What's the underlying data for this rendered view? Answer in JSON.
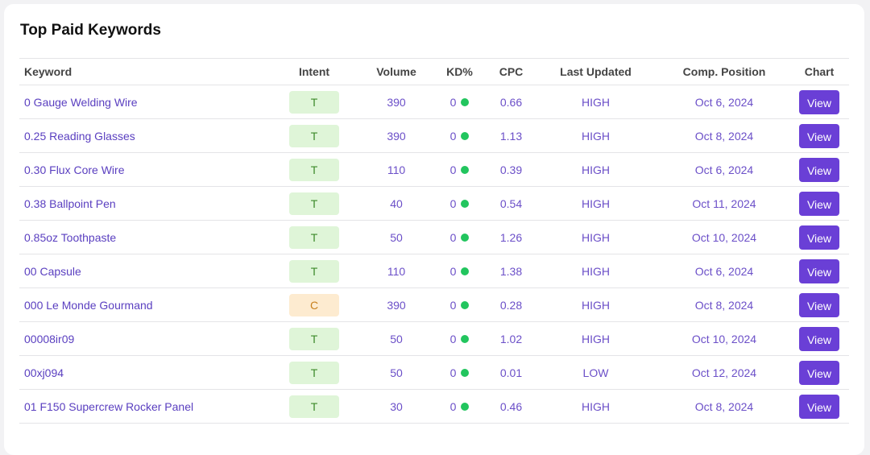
{
  "title": "Top Paid Keywords",
  "colors": {
    "accent": "#6a3fd6",
    "intent_t_bg": "#dff5d8",
    "intent_c_bg": "#fdebd0",
    "kd_dot": "#22c55e"
  },
  "columns": [
    "Keyword",
    "Intent",
    "Volume",
    "KD%",
    "CPC",
    "Last Updated",
    "Comp. Position",
    "Chart"
  ],
  "rows": [
    {
      "keyword": "0 Gauge Welding Wire",
      "intent": "T",
      "volume": "390",
      "kd": "0",
      "cpc": "0.66",
      "last_updated": "HIGH",
      "comp_position": "Oct 6, 2024",
      "chart": "View"
    },
    {
      "keyword": "0.25 Reading Glasses",
      "intent": "T",
      "volume": "390",
      "kd": "0",
      "cpc": "1.13",
      "last_updated": "HIGH",
      "comp_position": "Oct 8, 2024",
      "chart": "View"
    },
    {
      "keyword": "0.30 Flux Core Wire",
      "intent": "T",
      "volume": "110",
      "kd": "0",
      "cpc": "0.39",
      "last_updated": "HIGH",
      "comp_position": "Oct 6, 2024",
      "chart": "View"
    },
    {
      "keyword": "0.38 Ballpoint Pen",
      "intent": "T",
      "volume": "40",
      "kd": "0",
      "cpc": "0.54",
      "last_updated": "HIGH",
      "comp_position": "Oct 11, 2024",
      "chart": "View"
    },
    {
      "keyword": "0.85oz Toothpaste",
      "intent": "T",
      "volume": "50",
      "kd": "0",
      "cpc": "1.26",
      "last_updated": "HIGH",
      "comp_position": "Oct 10, 2024",
      "chart": "View"
    },
    {
      "keyword": "00 Capsule",
      "intent": "T",
      "volume": "110",
      "kd": "0",
      "cpc": "1.38",
      "last_updated": "HIGH",
      "comp_position": "Oct 6, 2024",
      "chart": "View"
    },
    {
      "keyword": "000 Le Monde Gourmand",
      "intent": "C",
      "volume": "390",
      "kd": "0",
      "cpc": "0.28",
      "last_updated": "HIGH",
      "comp_position": "Oct 8, 2024",
      "chart": "View"
    },
    {
      "keyword": "00008ir09",
      "intent": "T",
      "volume": "50",
      "kd": "0",
      "cpc": "1.02",
      "last_updated": "HIGH",
      "comp_position": "Oct 10, 2024",
      "chart": "View"
    },
    {
      "keyword": "00xj094",
      "intent": "T",
      "volume": "50",
      "kd": "0",
      "cpc": "0.01",
      "last_updated": "LOW",
      "comp_position": "Oct 12, 2024",
      "chart": "View"
    },
    {
      "keyword": "01 F150 Supercrew Rocker Panel",
      "intent": "T",
      "volume": "30",
      "kd": "0",
      "cpc": "0.46",
      "last_updated": "HIGH",
      "comp_position": "Oct 8, 2024",
      "chart": "View"
    }
  ]
}
